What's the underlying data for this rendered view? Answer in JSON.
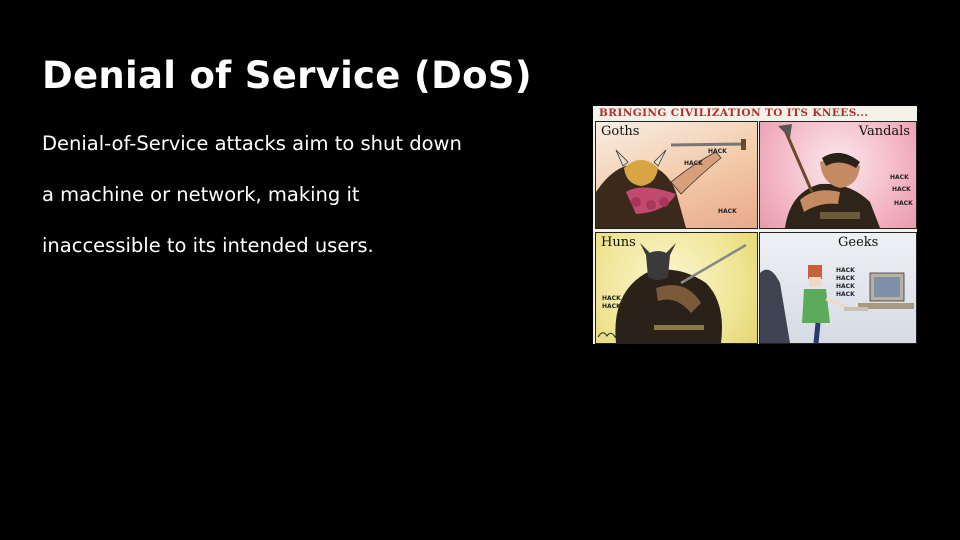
{
  "slide": {
    "title": "Denial of Service (DoS)",
    "body_lines": [
      "Denial-of-Service attacks aim to shut down",
      "a machine or network, making it",
      "inaccessible to its intended users."
    ]
  },
  "cartoon": {
    "header": "BRINGING CIVILIZATION TO ITS KNEES...",
    "panels": [
      {
        "label": "Goths",
        "sfx": "HACK"
      },
      {
        "label": "Vandals",
        "sfx": "HACK"
      },
      {
        "label": "Huns",
        "sfx": "HACK"
      },
      {
        "label": "Geeks",
        "sfx": "HACK"
      }
    ]
  },
  "colors": {
    "background": "#000000",
    "text": "#ffffff",
    "cartoon_header": "#b0302a"
  }
}
